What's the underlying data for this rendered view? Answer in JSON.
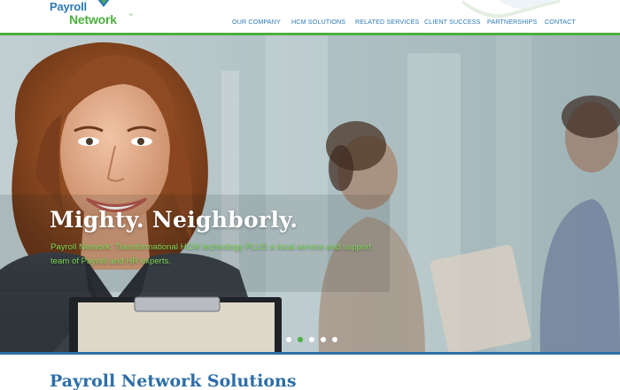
{
  "brand": {
    "name_line1": "Payroll",
    "name_line2": "Network",
    "trademark": "™",
    "colors": {
      "blue": "#2d7ab4",
      "green": "#4caf3f",
      "dark_blue": "#2f6ea6"
    }
  },
  "nav": {
    "items": [
      {
        "label": "OUR COMPANY"
      },
      {
        "label": "HCM SOLUTIONS"
      },
      {
        "label": "RELATED SERVICES"
      },
      {
        "label": "CLIENT SUCCESS"
      },
      {
        "label": "PARTNERSHIPS"
      },
      {
        "label": "CONTACT"
      }
    ]
  },
  "hero": {
    "title": "Mighty. Neighborly.",
    "subtitle": "Payroll Network: Transformational HCM technology PLUS a local service and support team of Payroll and HR experts.",
    "slides": {
      "count": 5,
      "active_index": 1
    }
  },
  "solutions": {
    "heading": "Payroll Network Solutions"
  }
}
